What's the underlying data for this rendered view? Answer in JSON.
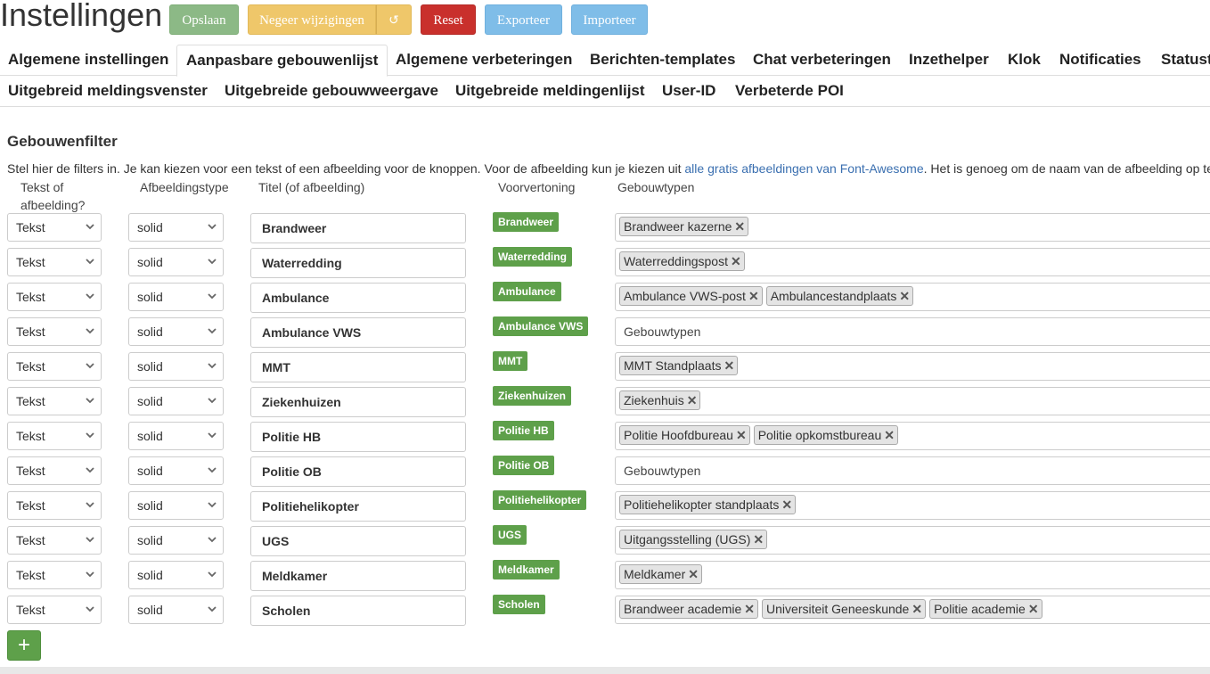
{
  "header": {
    "title": "Instellingen",
    "buttons": {
      "save": "Opslaan",
      "ignore": "Negeer wijzigingen",
      "undo_icon": "history-icon",
      "reset": "Reset",
      "export": "Exporteer",
      "import": "Importeer"
    }
  },
  "tabs_row1": [
    "Algemene instellingen",
    "Aanpasbare gebouwenlijst",
    "Algemene verbeteringen",
    "Berichten-templates",
    "Chat verbeteringen",
    "Inzethelper",
    "Klok",
    "Notificaties",
    "Statust"
  ],
  "active_tab": "Aanpasbare gebouwenlijst",
  "tabs_row2": [
    "Uitgebreid meldingsvenster",
    "Uitgebreide gebouwweergave",
    "Uitgebreide meldingenlijst",
    "User-ID",
    "Verbeterde POI"
  ],
  "section": {
    "title": "Gebouwenfilter",
    "desc_before": "Stel hier de filters in. Je kan kiezen voor een tekst of een afbeelding voor de knoppen. Voor de afbeelding kun je kiezen uit ",
    "desc_link": "alle gratis afbeeldingen van Font-Awesome",
    "desc_after": ". Het is genoeg om de naam van de afbeelding op te"
  },
  "columns": {
    "type": "Tekst of afbeelding?",
    "style": "Afbeeldingstype",
    "title": "Titel (of afbeelding)",
    "preview": "Voorvertoning",
    "buildings": "Gebouwtypen"
  },
  "tags_placeholder": "Gebouwtypen",
  "rows": [
    {
      "type": "Tekst",
      "style": "solid",
      "title": "Brandweer",
      "tags": [
        "Brandweer kazerne"
      ]
    },
    {
      "type": "Tekst",
      "style": "solid",
      "title": "Waterredding",
      "tags": [
        "Waterreddingspost"
      ]
    },
    {
      "type": "Tekst",
      "style": "solid",
      "title": "Ambulance",
      "tags": [
        "Ambulance VWS-post",
        "Ambulancestandplaats"
      ]
    },
    {
      "type": "Tekst",
      "style": "solid",
      "title": "Ambulance VWS",
      "tags": []
    },
    {
      "type": "Tekst",
      "style": "solid",
      "title": "MMT",
      "tags": [
        "MMT Standplaats"
      ]
    },
    {
      "type": "Tekst",
      "style": "solid",
      "title": "Ziekenhuizen",
      "tags": [
        "Ziekenhuis"
      ]
    },
    {
      "type": "Tekst",
      "style": "solid",
      "title": "Politie HB",
      "tags": [
        "Politie Hoofdbureau",
        "Politie opkomstbureau"
      ]
    },
    {
      "type": "Tekst",
      "style": "solid",
      "title": "Politie OB",
      "tags": []
    },
    {
      "type": "Tekst",
      "style": "solid",
      "title": "Politiehelikopter",
      "tags": [
        "Politiehelikopter standplaats"
      ]
    },
    {
      "type": "Tekst",
      "style": "solid",
      "title": "UGS",
      "tags": [
        "Uitgangsstelling (UGS)"
      ]
    },
    {
      "type": "Tekst",
      "style": "solid",
      "title": "Meldkamer",
      "tags": [
        "Meldkamer"
      ]
    },
    {
      "type": "Tekst",
      "style": "solid",
      "title": "Scholen",
      "tags": [
        "Brandweer academie",
        "Universiteit Geneeskunde",
        "Politie academie"
      ]
    }
  ],
  "add_button": "+",
  "colors": {
    "save": "#8cb986",
    "ignore": "#efc76a",
    "reset": "#c9302c",
    "export_import": "#7fbde8",
    "preview": "#5ea04a"
  }
}
